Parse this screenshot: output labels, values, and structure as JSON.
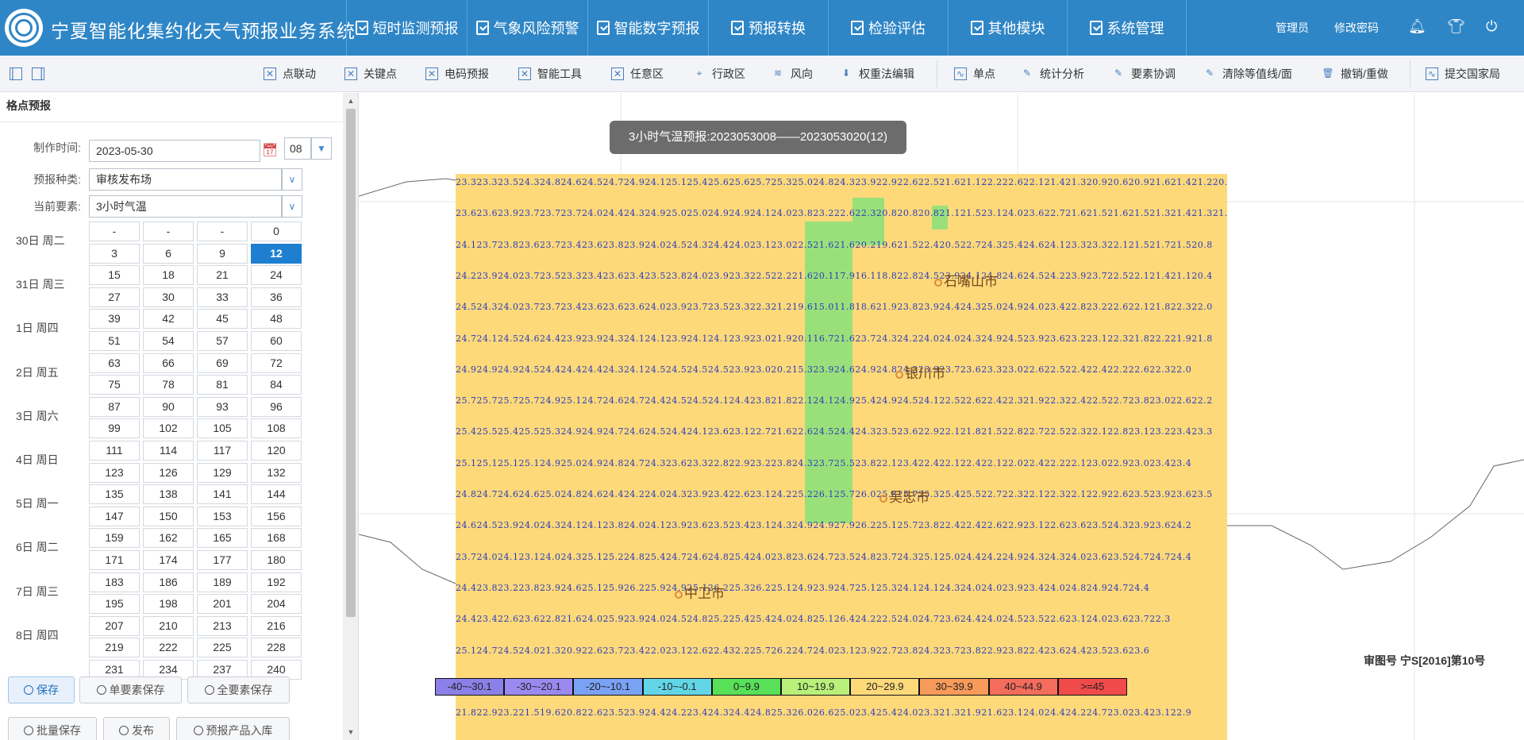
{
  "header": {
    "app_title": "宁夏智能化集约化天气预报业务系统",
    "nav": [
      {
        "label": "短时监测预报"
      },
      {
        "label": "气象风险预警"
      },
      {
        "label": "智能数字预报"
      },
      {
        "label": "预报转换"
      },
      {
        "label": "检验评估"
      },
      {
        "label": "其他模块"
      },
      {
        "label": "系统管理"
      }
    ],
    "user_label": "管理员",
    "change_password_label": "修改密码",
    "icons": [
      "bell-icon",
      "shirt-icon",
      "power-icon"
    ]
  },
  "toolbar": {
    "items": [
      {
        "label": "点联动",
        "icon": "grid-x-icon"
      },
      {
        "label": "关键点",
        "icon": "grid-x-icon"
      },
      {
        "label": "电码预报",
        "icon": "grid-x-icon"
      },
      {
        "label": "智能工具",
        "icon": "grid-x-icon"
      },
      {
        "label": "任意区",
        "icon": "grid-x-icon"
      },
      {
        "label": "行政区",
        "icon": "pin-icon"
      },
      {
        "label": "风向",
        "icon": "wind-icon"
      },
      {
        "label": "权重法编辑",
        "icon": "stamp-icon"
      },
      {
        "label": "单点",
        "icon": "chart-icon"
      },
      {
        "label": "统计分析",
        "icon": "pen-icon"
      },
      {
        "label": "要素协调",
        "icon": "pen-icon"
      },
      {
        "label": "清除等值线/面",
        "icon": "pen-icon"
      },
      {
        "label": "撤销/重做",
        "icon": "trash-icon"
      },
      {
        "label": "提交国家局",
        "icon": "chart-icon"
      }
    ]
  },
  "panel": {
    "title": "格点预报",
    "make_time_label": "制作时间:",
    "make_date": "2023-05-30",
    "make_hour": "08",
    "forecast_type_label": "预报种类:",
    "forecast_type": "审核发布场",
    "element_label": "当前要素:",
    "element": "3小时气温",
    "days": [
      {
        "label": "30日 周二",
        "rows": [
          [
            "-",
            "-",
            "-",
            "0"
          ],
          [
            "3",
            "6",
            "9",
            "12"
          ]
        ]
      },
      {
        "label": "31日 周三",
        "rows": [
          [
            "15",
            "18",
            "21",
            "24"
          ],
          [
            "27",
            "30",
            "33",
            "36"
          ]
        ]
      },
      {
        "label": "1日 周四",
        "rows": [
          [
            "39",
            "42",
            "45",
            "48"
          ],
          [
            "51",
            "54",
            "57",
            "60"
          ]
        ]
      },
      {
        "label": "2日 周五",
        "rows": [
          [
            "63",
            "66",
            "69",
            "72"
          ],
          [
            "75",
            "78",
            "81",
            "84"
          ]
        ]
      },
      {
        "label": "3日 周六",
        "rows": [
          [
            "87",
            "90",
            "93",
            "96"
          ],
          [
            "99",
            "102",
            "105",
            "108"
          ]
        ]
      },
      {
        "label": "4日 周日",
        "rows": [
          [
            "111",
            "114",
            "117",
            "120"
          ],
          [
            "123",
            "126",
            "129",
            "132"
          ]
        ]
      },
      {
        "label": "5日 周一",
        "rows": [
          [
            "135",
            "138",
            "141",
            "144"
          ],
          [
            "147",
            "150",
            "153",
            "156"
          ]
        ]
      },
      {
        "label": "6日 周二",
        "rows": [
          [
            "159",
            "162",
            "165",
            "168"
          ],
          [
            "171",
            "174",
            "177",
            "180"
          ]
        ]
      },
      {
        "label": "7日 周三",
        "rows": [
          [
            "183",
            "186",
            "189",
            "192"
          ],
          [
            "195",
            "198",
            "201",
            "204"
          ]
        ]
      },
      {
        "label": "8日 周四",
        "rows": [
          [
            "207",
            "210",
            "213",
            "216"
          ],
          [
            "219",
            "222",
            "225",
            "228"
          ]
        ]
      },
      {
        "label": "",
        "rows": [
          [
            "231",
            "234",
            "237",
            "240"
          ]
        ]
      }
    ],
    "selected_hour": "12",
    "buttons": {
      "save": "保存",
      "save_single": "单要素保存",
      "save_all": "全要素保存",
      "batch_save": "批量保存",
      "publish": "发布",
      "product_store": "预报产品入库"
    }
  },
  "map": {
    "title": "3小时气温预报:2023053008——2023053020(12)",
    "approval_no": "审图号 宁S[2016]第10号",
    "cities": [
      {
        "name": "石嘴山市"
      },
      {
        "name": "银川市"
      },
      {
        "name": "吴忠市"
      },
      {
        "name": "中卫市"
      }
    ],
    "grid_rows": [
      "23.323.323.524.324.824.624.524.724.924.125.125.425.625.625.725.325.024.824.323.922.922.622.521.621.122.222.622.121.421.320.920.620.921.621.421.220.6",
      "23.623.623.923.723.723.724.024.424.324.925.025.024.924.924.124.023.823.222.622.320.820.820.821.121.523.124.023.622.721.621.521.621.521.321.421.321.2",
      "24.123.723.823.623.723.423.623.823.924.024.524.324.424.023.123.022.521.621.620.219.621.522.420.522.724.325.424.624.123.323.322.121.521.721.520.8",
      "24.223.924.023.723.523.323.423.623.423.523.824.023.923.322.522.221.620.117.916.118.822.824.523.924.124.824.624.524.223.923.722.522.121.421.120.4",
      "24.524.324.023.723.723.423.623.623.624.023.923.723.523.322.321.219.615.011.818.621.923.823.924.424.325.024.924.023.422.823.222.622.121.822.322.0",
      "24.724.124.524.624.423.923.924.324.124.123.924.124.123.923.021.920.116.721.623.724.324.224.024.024.324.924.523.923.623.223.122.321.822.221.921.8",
      "24.924.924.924.524.424.424.424.324.124.524.524.524.523.923.020.215.323.924.624.924.824.323.923.723.623.323.022.622.522.422.422.222.622.322.0",
      "25.725.725.725.724.925.124.724.624.724.424.524.524.124.423.821.822.124.124.925.424.924.524.122.522.622.422.321.922.322.422.522.723.823.022.622.2",
      "25.425.525.425.525.324.924.924.724.624.524.424.123.623.122.721.622.624.524.424.323.523.622.922.121.821.522.822.722.522.322.122.823.123.223.423.3",
      "25.125.125.125.124.925.024.924.824.724.323.623.322.822.923.223.824.323.725.523.822.123.422.422.122.422.122.022.422.222.123.022.923.023.423.4",
      "24.824.724.624.625.024.824.624.424.224.024.323.923.422.623.124.225.226.125.726.025.825.725.325.425.522.722.322.122.322.122.922.623.523.923.623.5",
      "24.624.523.924.024.324.124.123.824.024.123.923.623.523.423.124.324.924.927.926.225.125.723.822.422.422.622.923.122.623.623.524.323.923.624.2",
      "23.724.024.123.124.024.325.125.224.825.424.724.624.825.424.023.823.624.723.524.823.724.325.125.024.424.224.924.324.324.023.623.524.724.724.4",
      "24.423.823.223.823.924.625.125.926.225.924.925.126.225.326.225.124.923.924.725.125.324.124.124.324.024.023.923.424.024.824.924.724.4",
      "24.423.422.623.622.821.624.025.923.924.024.524.825.225.425.424.024.825.126.424.222.524.024.723.624.424.024.523.522.623.124.023.623.722.3",
      "25.124.724.524.021.320.922.623.723.422.023.122.622.432.225.726.224.724.023.123.922.723.824.323.723.822.923.822.423.624.423.523.623.6",
      "",
      "21.822.923.221.519.620.822.623.523.924.424.223.424.324.424.825.326.026.625.023.425.424.023.321.321.921.623.124.024.424.224.723.023.423.122.9"
    ],
    "legend": [
      {
        "label": "-40~-30.1",
        "color": "#8b7fe8"
      },
      {
        "label": "-30~-20.1",
        "color": "#9a8af0"
      },
      {
        "label": "-20~-10.1",
        "color": "#7aa2f5"
      },
      {
        "label": "-10~-0.1",
        "color": "#62d6e6"
      },
      {
        "label": "0~9.9",
        "color": "#58e058"
      },
      {
        "label": "10~19.9",
        "color": "#b8f07a"
      },
      {
        "label": "20~29.9",
        "color": "#fdd97a"
      },
      {
        "label": "30~39.9",
        "color": "#f79a5a"
      },
      {
        "label": "40~44.9",
        "color": "#f36c5c"
      },
      {
        "label": ">=45",
        "color": "#f04a4a"
      }
    ]
  }
}
